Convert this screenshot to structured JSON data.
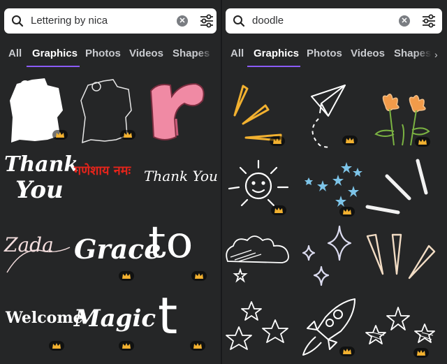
{
  "colors": {
    "accent": "#8b5cf6",
    "panel": "#252627",
    "crown": "#f2b130"
  },
  "panels": [
    {
      "search": {
        "query": "Lettering by nica",
        "icon": "search-icon",
        "clear_icon": "clear-icon",
        "filter_icon": "filter-icon"
      },
      "tabs": [
        {
          "label": "All",
          "active": false
        },
        {
          "label": "Graphics",
          "active": true
        },
        {
          "label": "Photos",
          "active": false
        },
        {
          "label": "Videos",
          "active": false
        },
        {
          "label": "Shapes",
          "active": false
        }
      ],
      "items": [
        {
          "name": "couple-silhouette",
          "premium": true
        },
        {
          "name": "couple-outline",
          "premium": true
        },
        {
          "name": "letter-r-pink",
          "premium": false
        },
        {
          "name": "thank-you-lettering",
          "text_line1": "Thank",
          "text_line2": "You",
          "premium": false
        },
        {
          "name": "ganeshaya-namah",
          "text": "गणेशाय नमः",
          "premium": false
        },
        {
          "name": "thank-you-script",
          "text": "Thank You",
          "premium": false
        },
        {
          "name": "zada-script",
          "text": "Zada",
          "premium": false
        },
        {
          "name": "grace-lettering",
          "text": "Grace",
          "premium": true
        },
        {
          "name": "to-lettering",
          "text": "to",
          "premium": true
        },
        {
          "name": "welcome-lettering",
          "text": "Welcome",
          "premium": true
        },
        {
          "name": "magic-lettering",
          "text": "Magic",
          "premium": true
        },
        {
          "name": "letter-t-heart",
          "text": "t",
          "premium": true
        }
      ]
    },
    {
      "search": {
        "query": "doodle",
        "icon": "search-icon",
        "clear_icon": "clear-icon",
        "filter_icon": "filter-icon"
      },
      "tabs": [
        {
          "label": "All",
          "active": false
        },
        {
          "label": "Graphics",
          "active": true
        },
        {
          "label": "Photos",
          "active": false
        },
        {
          "label": "Videos",
          "active": false
        },
        {
          "label": "Shapes",
          "active": false
        }
      ],
      "items": [
        {
          "name": "yellow-rays",
          "premium": true
        },
        {
          "name": "paper-plane",
          "premium": true
        },
        {
          "name": "orange-flowers",
          "premium": true
        },
        {
          "name": "smiling-sun",
          "premium": true
        },
        {
          "name": "blue-stars",
          "premium": true
        },
        {
          "name": "white-strokes",
          "premium": false
        },
        {
          "name": "cloud-doodle",
          "premium": false
        },
        {
          "name": "sparkles",
          "premium": false
        },
        {
          "name": "beige-rays",
          "premium": false
        },
        {
          "name": "outline-stars",
          "premium": false
        },
        {
          "name": "rocket",
          "premium": true
        },
        {
          "name": "striped-stars",
          "premium": true
        }
      ]
    }
  ]
}
